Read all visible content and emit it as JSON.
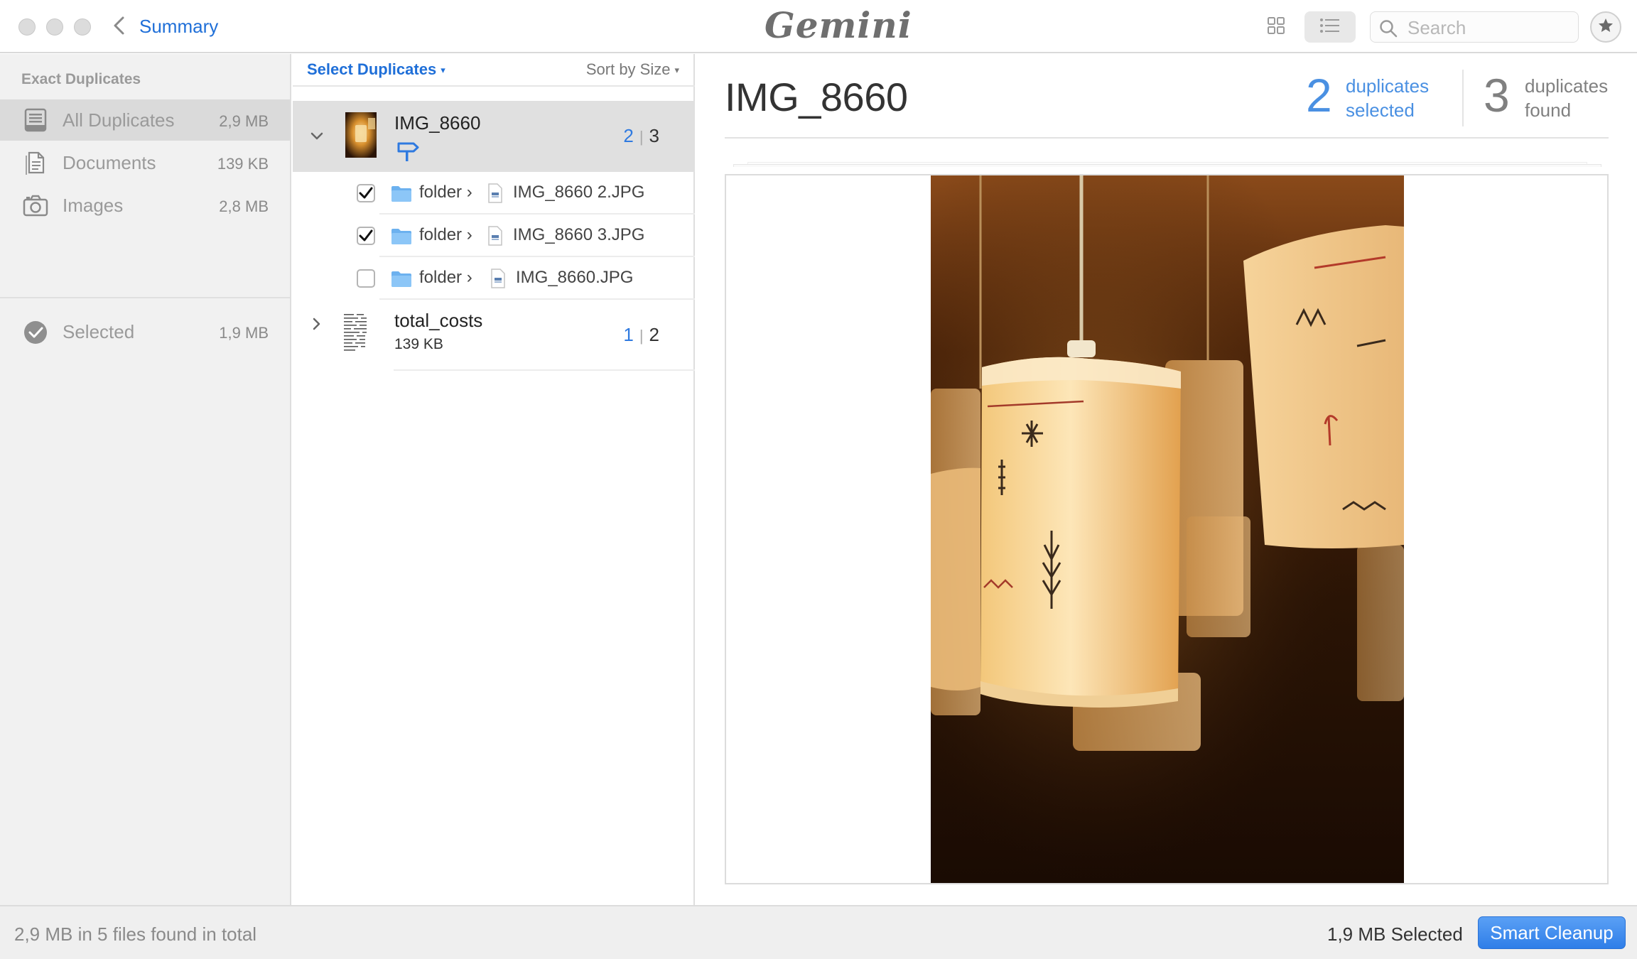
{
  "window": {
    "app_name": "Gemini"
  },
  "toolbar": {
    "back_label": "Summary",
    "search_placeholder": "Search"
  },
  "sidebar": {
    "heading": "Exact Duplicates",
    "items": [
      {
        "label": "All Duplicates",
        "size": "2,9 MB",
        "icon": "tray-icon",
        "active": true
      },
      {
        "label": "Documents",
        "size": "139 KB",
        "icon": "document-icon",
        "active": false
      },
      {
        "label": "Images",
        "size": "2,8 MB",
        "icon": "camera-icon",
        "active": false
      }
    ],
    "selected": {
      "label": "Selected",
      "size": "1,9 MB",
      "icon": "checkmark-circle-icon"
    }
  },
  "list": {
    "select_label": "Select Duplicates",
    "sort_label": "Sort by Size",
    "groups": [
      {
        "name": "IMG_8660",
        "selected_count": "2",
        "total_count": "3",
        "expanded": true,
        "files": [
          {
            "folder": "folder",
            "name": "IMG_8660 2.JPG",
            "checked": true
          },
          {
            "folder": "folder",
            "name": "IMG_8660 3.JPG",
            "checked": true
          },
          {
            "folder": "folder",
            "name": "IMG_8660.JPG",
            "checked": false
          }
        ]
      },
      {
        "name": "total_costs",
        "size": "139 KB",
        "selected_count": "1",
        "total_count": "2",
        "expanded": false
      }
    ]
  },
  "preview": {
    "title": "IMG_8660",
    "selected_num": "2",
    "selected_text_1": "duplicates",
    "selected_text_2": "selected",
    "found_num": "3",
    "found_text_1": "duplicates",
    "found_text_2": "found"
  },
  "status": {
    "summary": "2,9 MB in 5 files found in total",
    "selected": "1,9 MB Selected",
    "cleanup_label": "Smart Cleanup"
  },
  "colors": {
    "accent": "#1f6fd8",
    "stat_blue": "#4a90e2",
    "button": "#2f7ee8"
  }
}
